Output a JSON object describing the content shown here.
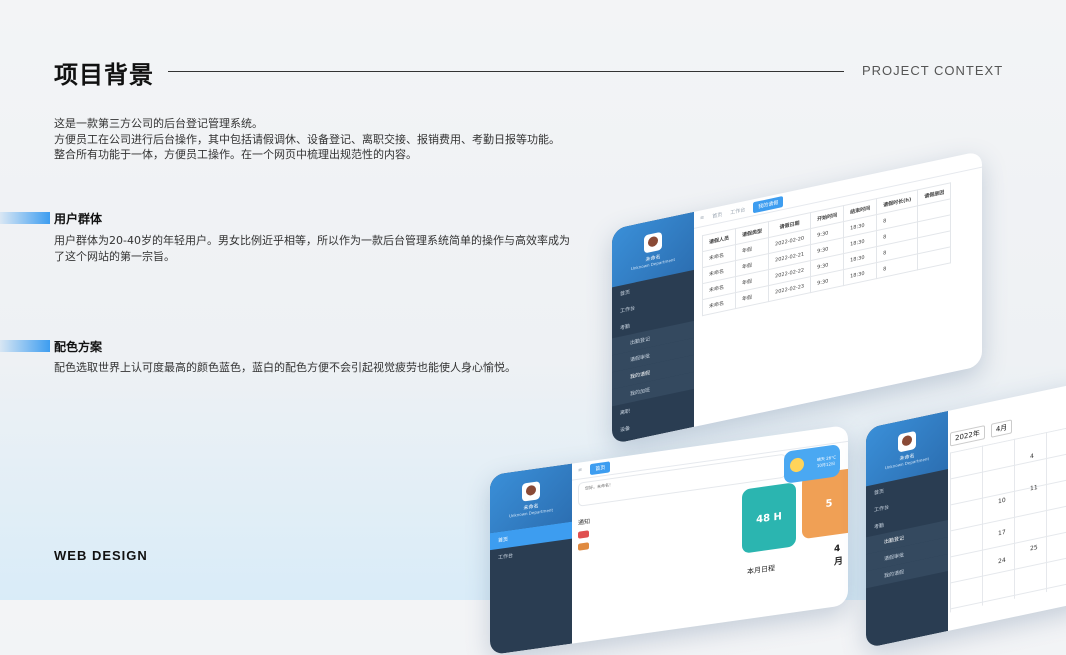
{
  "header": {
    "title": "项目背景",
    "title_en": "PROJECT CONTEXT"
  },
  "intro": {
    "lines": [
      "这是一款第三方公司的后台登记管理系统。",
      "方便员工在公司进行后台操作，其中包括请假调休、设备登记、离职交接、报销费用、考勤日报等功能。",
      "整合所有功能于一体，方便员工操作。在一个网页中梳理出规范性的内容。"
    ]
  },
  "sections": [
    {
      "title": "用户群体",
      "body": "用户群体为20-40岁的年轻用户。男女比例近乎相等，所以作为一款后台管理系统简单的操作与高效率成为了这个网站的第一宗旨。"
    },
    {
      "title": "配色方案",
      "body": "配色选取世界上认可度最高的颜色蓝色，蓝白的配色方便不会引起视觉疲劳也能使人身心愉悦。"
    }
  ],
  "footer": {
    "label": "WEB DESIGN"
  },
  "mockups": {
    "user_name": "未命名",
    "user_dept": "Unknown Department",
    "sidebar": [
      "首页",
      "工作台",
      "考勤",
      "出勤登记",
      "请假审批",
      "我的请假",
      "我的加班",
      "离职",
      "设备",
      "费用管理"
    ],
    "table": {
      "headers": [
        "请假人员",
        "请假类型",
        "请假日期",
        "开始时间",
        "结束时间",
        "请假时长(h)",
        "请假原因"
      ],
      "rows": [
        [
          "未命名",
          "年假",
          "2022-02-20",
          "9:30",
          "18:30",
          "8",
          ""
        ],
        [
          "未命名",
          "年假",
          "2022-02-21",
          "9:30",
          "18:30",
          "8",
          ""
        ],
        [
          "未命名",
          "年假",
          "2022-02-22",
          "9:30",
          "18:30",
          "8",
          ""
        ],
        [
          "未命名",
          "年假",
          "2022-02-23",
          "9:30",
          "18:30",
          "8",
          ""
        ]
      ]
    },
    "dashboard": {
      "greeting": "您好，未命名！",
      "notice_title": "通知",
      "hours": "48 H",
      "count": "5",
      "month": "4月",
      "schedule_title": "本月日程",
      "weather_text": "晴天 26°C",
      "weather_date": "10月12日"
    },
    "calendar": {
      "year": "2022年",
      "month": "4月",
      "days": [
        "4",
        "10",
        "11",
        "17",
        "24",
        "25"
      ]
    }
  }
}
